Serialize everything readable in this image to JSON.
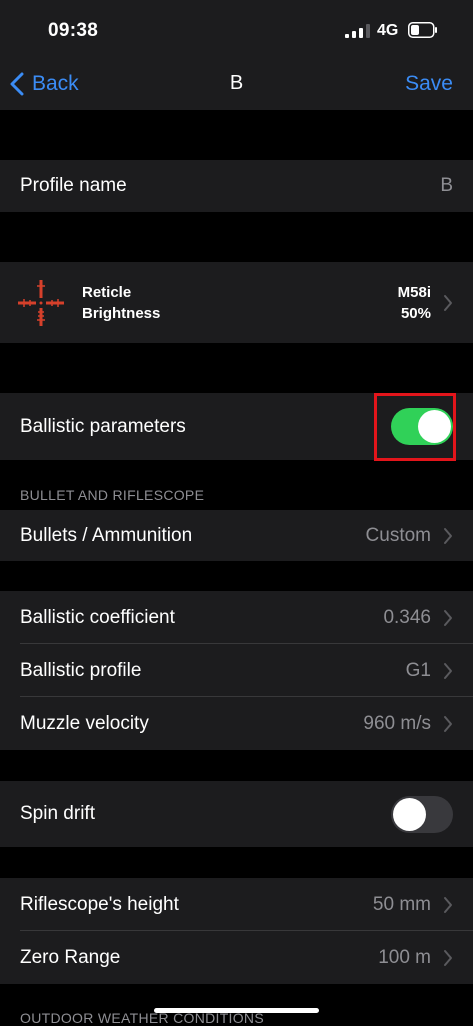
{
  "status_bar": {
    "time": "09:38",
    "network": "4G"
  },
  "nav": {
    "back_label": "Back",
    "title": "B",
    "save_label": "Save"
  },
  "profile": {
    "label": "Profile name",
    "value": "B"
  },
  "reticle": {
    "line1": "Reticle",
    "line2": "Brightness",
    "value1": "M58i",
    "value2": "50%"
  },
  "ballistic": {
    "label": "Ballistic parameters",
    "enabled": true
  },
  "section_bullet": "BULLET AND RIFLESCOPE",
  "bullets": {
    "label": "Bullets / Ammunition",
    "value": "Custom"
  },
  "coefficient": {
    "label": "Ballistic coefficient",
    "value": "0.346"
  },
  "ballistic_profile": {
    "label": "Ballistic profile",
    "value": "G1"
  },
  "muzzle": {
    "label": "Muzzle velocity",
    "value": "960 m/s"
  },
  "spin": {
    "label": "Spin drift",
    "enabled": false
  },
  "scope_height": {
    "label": "Riflescope's height",
    "value": "50 mm"
  },
  "zero_range": {
    "label": "Zero Range",
    "value": "100 m"
  },
  "section_weather": "OUTDOOR WEATHER CONDITIONS",
  "colors": {
    "accent": "#3b8cf5",
    "toggle_on": "#30d158",
    "reticle": "#d6402b",
    "highlight": "#e3151b"
  },
  "icons": [
    "chevron-left-icon",
    "chevron-right-icon",
    "reticle-icon",
    "signal-icon",
    "battery-icon"
  ]
}
